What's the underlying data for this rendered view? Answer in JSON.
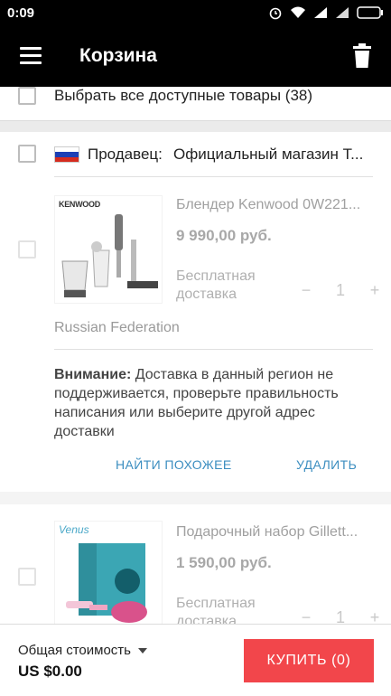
{
  "status_bar": {
    "time": "0:09"
  },
  "app_bar": {
    "title": "Корзина"
  },
  "select_all": {
    "label": "Выбрать все доступные товары (38)"
  },
  "seller": {
    "label": "Продавец:",
    "name": "Официальный магазин Т..."
  },
  "products": [
    {
      "name": "Блендер Kenwood 0W221...",
      "price": "9 990,00 руб.",
      "shipping": "Бесплатная доставка",
      "quantity": "1",
      "brand_text": "KENWOOD"
    },
    {
      "name": "Подарочный набор Gillett...",
      "price": "1 590,00 руб.",
      "shipping": "Бесплатная доставка",
      "quantity": "1",
      "brand_text": "Venus"
    }
  ],
  "region": "Russian Federation",
  "warning": {
    "bold": "Внимание:",
    "text": " Доставка в данный регион не поддерживается, проверьте правильность написания или выберите другой адрес доставки"
  },
  "actions": {
    "find_similar": "НАЙТИ ПОХОЖЕЕ",
    "delete": "УДАЛИТЬ"
  },
  "qty_controls": {
    "minus": "−",
    "plus": "+"
  },
  "footer": {
    "total_label": "Общая стоимость",
    "total_value": "US $0.00",
    "buy_label": "КУПИТЬ (0)"
  },
  "colors": {
    "buy_button": "#f2464b",
    "action_link": "#3c8ec0",
    "app_bar": "#000000"
  }
}
